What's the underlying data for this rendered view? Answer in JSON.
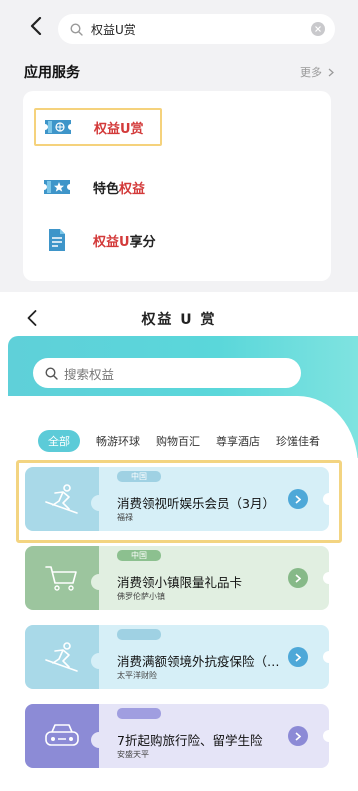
{
  "search_screen": {
    "query": "权益U赏",
    "section_title": "应用服务",
    "more_label": "更多",
    "services": [
      {
        "parts": [
          {
            "text": "权益U赏",
            "color": "red"
          }
        ],
        "icon": "globe-ticket-icon"
      },
      {
        "parts": [
          {
            "text": "特色",
            "color": "dark"
          },
          {
            "text": "权益",
            "color": "red"
          }
        ],
        "icon": "star-ticket-icon"
      },
      {
        "parts": [
          {
            "text": "权益U",
            "color": "red"
          },
          {
            "text": "享分",
            "color": "dark"
          }
        ],
        "icon": "document-icon"
      }
    ]
  },
  "rights_screen": {
    "title": "权益 U 赏",
    "search_placeholder": "搜索权益",
    "tabs": [
      "全部",
      "畅游环球",
      "购物百汇",
      "尊享酒店",
      "珍馐佳肴"
    ],
    "coupons": [
      {
        "tag": "中国",
        "name": "消费领视听娱乐会员（3月）",
        "merchant": "福禄",
        "theme": "blue",
        "icon": "skiing-icon"
      },
      {
        "tag": "中国",
        "name": "消费领小镇限量礼品卡",
        "merchant": "佛罗伦萨小镇",
        "theme": "green",
        "icon": "shopping-cart-icon"
      },
      {
        "tag": "",
        "name": "消费满额领境外抗疫保险（1…",
        "merchant": "太平洋财险",
        "theme": "blue",
        "icon": "skiing-icon"
      },
      {
        "tag": "",
        "name": "7折起购旅行险、留学生险",
        "merchant": "安盛天平",
        "theme": "purple",
        "icon": "car-icon"
      }
    ]
  },
  "colors": {
    "accent_red": "#d33a3a",
    "teal": "#5ccbd8",
    "highlight": "#f3d481"
  }
}
